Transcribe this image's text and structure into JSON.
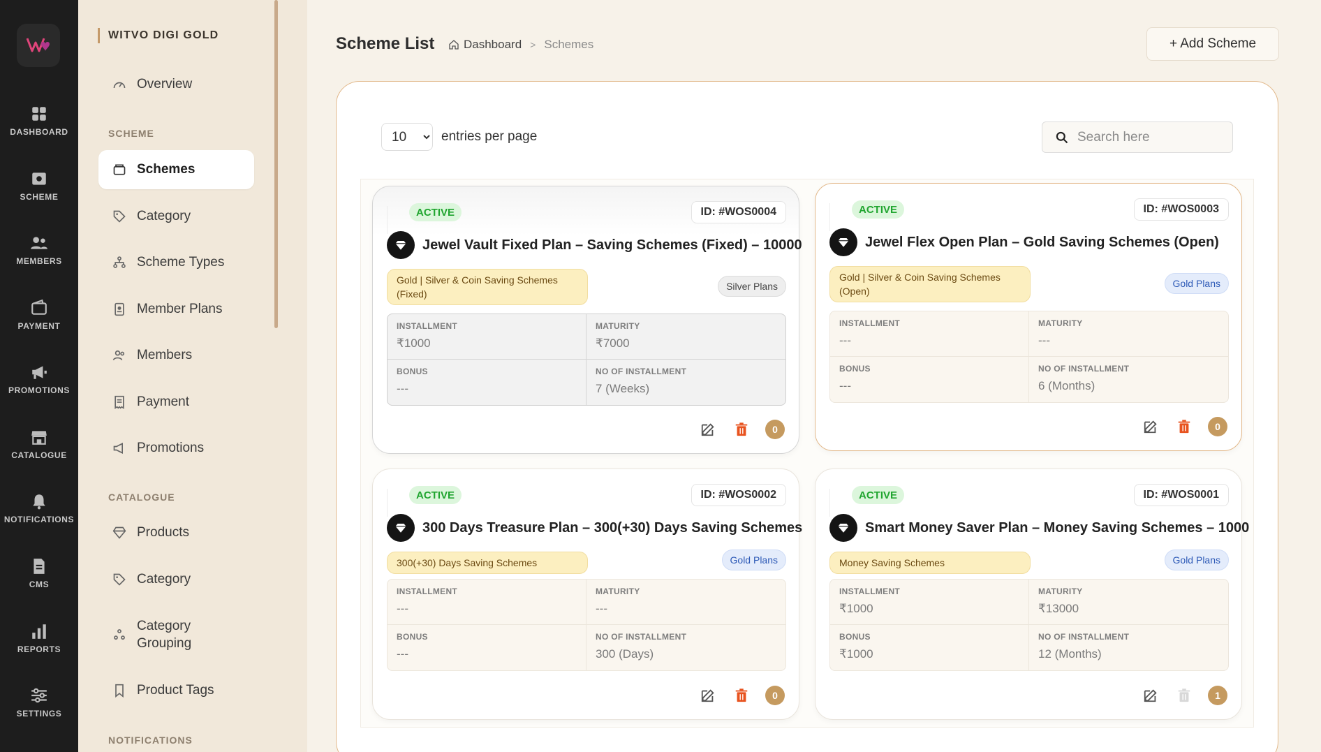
{
  "rail": {
    "items": [
      {
        "label": "DASHBOARD",
        "icon": "dashboard-icon"
      },
      {
        "label": "SCHEME",
        "icon": "scheme-icon"
      },
      {
        "label": "MEMBERS",
        "icon": "members-icon"
      },
      {
        "label": "PAYMENT",
        "icon": "wallet-icon"
      },
      {
        "label": "PROMOTIONS",
        "icon": "megaphone-icon"
      },
      {
        "label": "CATALOGUE",
        "icon": "store-icon"
      },
      {
        "label": "NOTIFICATIONS",
        "icon": "bell-icon"
      },
      {
        "label": "CMS",
        "icon": "document-icon"
      },
      {
        "label": "REPORTS",
        "icon": "bar-chart-icon"
      },
      {
        "label": "SETTINGS",
        "icon": "sliders-icon"
      }
    ]
  },
  "sidebar": {
    "brand": "WITVO DIGI GOLD",
    "overview": "Overview",
    "scheme_section": "SCHEME",
    "scheme_items": [
      "Schemes",
      "Category",
      "Scheme Types",
      "Member Plans",
      "Members",
      "Payment",
      "Promotions"
    ],
    "catalogue_section": "CATALOGUE",
    "catalogue_items": [
      "Products",
      "Category",
      "Category Grouping",
      "Product Tags"
    ],
    "notifications_section": "NOTIFICATIONS"
  },
  "header": {
    "title": "Scheme List",
    "breadcrumb_home": "Dashboard",
    "breadcrumb_sep": ">",
    "breadcrumb_current": "Schemes",
    "add_button": "+ Add Scheme"
  },
  "toolbar": {
    "entries_value": "10",
    "entries_text": "entries per page",
    "search_placeholder": "Search here"
  },
  "labels": {
    "installment": "INSTALLMENT",
    "maturity": "MATURITY",
    "bonus": "BONUS",
    "no_of_installment": "NO OF INSTALLMENT"
  },
  "cards": [
    {
      "status": "ACTIVE",
      "id": "ID: #WOS0004",
      "title": "Jewel Vault Fixed Plan – Saving Schemes (Fixed) – 10000",
      "category": "Gold | Silver & Coin Saving Schemes (Fixed)",
      "plan": "Silver Plans",
      "installment": "₹1000",
      "maturity": "₹7000",
      "bonus": "---",
      "no_of_installment": "7 (Weeks)",
      "count": "0"
    },
    {
      "status": "ACTIVE",
      "id": "ID: #WOS0003",
      "title": "Jewel Flex Open Plan – Gold Saving Schemes (Open)",
      "category": "Gold | Silver & Coin Saving Schemes (Open)",
      "plan": "Gold Plans",
      "installment": "---",
      "maturity": "---",
      "bonus": "---",
      "no_of_installment": "6 (Months)",
      "count": "0"
    },
    {
      "status": "ACTIVE",
      "id": "ID: #WOS0002",
      "title": "300 Days Treasure Plan – 300(+30) Days Saving Schemes",
      "category": "300(+30) Days Saving Schemes",
      "plan": "Gold Plans",
      "installment": "---",
      "maturity": "---",
      "bonus": "---",
      "no_of_installment": "300 (Days)",
      "count": "0"
    },
    {
      "status": "ACTIVE",
      "id": "ID: #WOS0001",
      "title": "Smart Money Saver Plan – Money Saving Schemes – 1000",
      "category": "Money Saving Schemes",
      "plan": "Gold Plans",
      "installment": "₹1000",
      "maturity": "₹13000",
      "bonus": "₹1000",
      "no_of_installment": "12 (Months)",
      "count": "1"
    }
  ],
  "colors": {
    "rail_bg": "#1d1d1d",
    "sidebar_bg": "#f1e8da",
    "accent_gold": "#c59a5f",
    "active_green": "#20a52f",
    "delete_orange": "#e8531f",
    "logo_pink": "#e0457b"
  }
}
